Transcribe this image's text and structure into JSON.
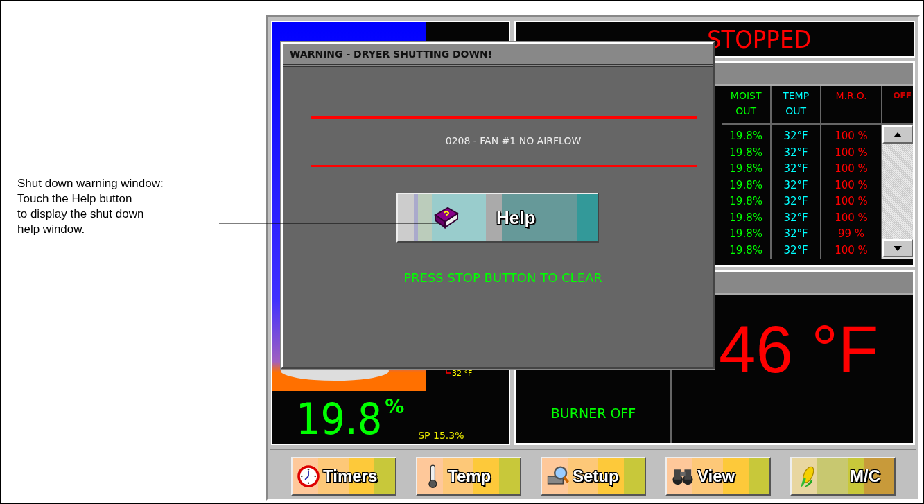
{
  "annotation": {
    "text": "Shut down warning window:\nTouch the Help button\nto display the shut down\nhelp window."
  },
  "status_title": "STOPPED",
  "moisture": {
    "value": "19.8",
    "unit": "%",
    "setpoint": "SP 15.3%",
    "temp_label": "32 °F"
  },
  "table": {
    "columns": [
      {
        "label": "MOIST OUT",
        "color": "#00ff00"
      },
      {
        "label": "TEMP OUT",
        "color": "#00ffff"
      },
      {
        "label": "M.R.O.",
        "color": "#ff0000"
      },
      {
        "label": "OFF",
        "color": "#cc0000"
      }
    ],
    "rows": [
      {
        "cells": [
          "19.8%",
          "32°F",
          "100 %"
        ]
      },
      {
        "cells": [
          "19.8%",
          "32°F",
          "100 %"
        ]
      },
      {
        "cells": [
          "19.8%",
          "32°F",
          "100 %"
        ]
      },
      {
        "cells": [
          "19.8%",
          "32°F",
          "100 %"
        ]
      },
      {
        "cells": [
          "19.8%",
          "32°F",
          "100 %"
        ]
      },
      {
        "cells": [
          "19.8%",
          "32°F",
          "100 %"
        ]
      },
      {
        "cells": [
          "19.8%",
          "32°F",
          "99 %"
        ]
      },
      {
        "cells": [
          "19.8%",
          "32°F",
          "100 %"
        ]
      }
    ]
  },
  "burner": {
    "status": "BURNER OFF",
    "temperature": "46 °F"
  },
  "dialog": {
    "title": "WARNING - DRYER SHUTTING DOWN!",
    "message": "0208 - FAN #1 NO AIRFLOW",
    "help_button": "Help",
    "instruction": "PRESS STOP BUTTON TO CLEAR"
  },
  "nav_buttons": [
    {
      "label": "Timers",
      "kind": "clock"
    },
    {
      "label": "Temp",
      "kind": "thermometer"
    },
    {
      "label": "Setup",
      "kind": "magnifier"
    },
    {
      "label": "View",
      "kind": "binoculars"
    },
    {
      "label": "M/C",
      "kind": "corn"
    }
  ]
}
